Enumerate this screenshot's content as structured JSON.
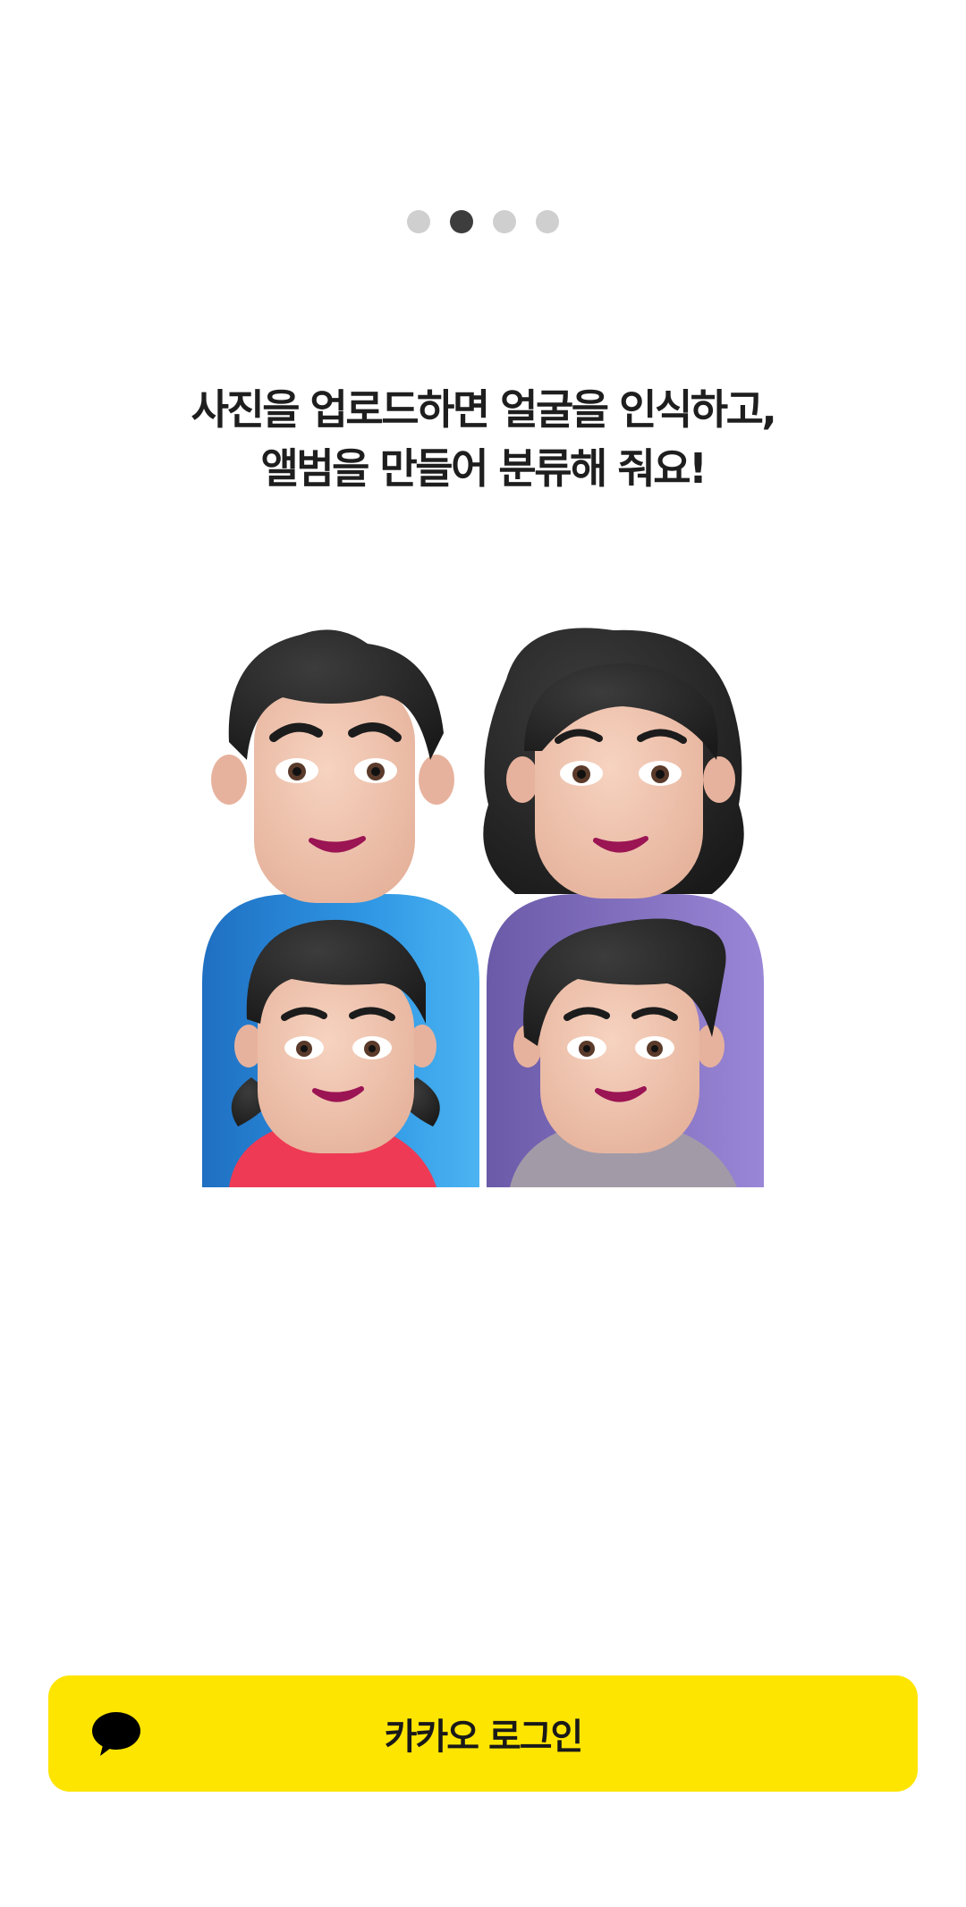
{
  "pager": {
    "count": 4,
    "active_index": 1
  },
  "onboarding": {
    "line1": "사진을 업로드하면 얼굴을 인식하고,",
    "line2": "앨범을 만들어 분류해 줘요!"
  },
  "login": {
    "label": "카카오 로그인",
    "icon": "speech-bubble-icon"
  },
  "colors": {
    "kakao_yellow": "#FEE500",
    "dot_active": "#3D3D3D",
    "dot_inactive": "#CFCFCF"
  }
}
